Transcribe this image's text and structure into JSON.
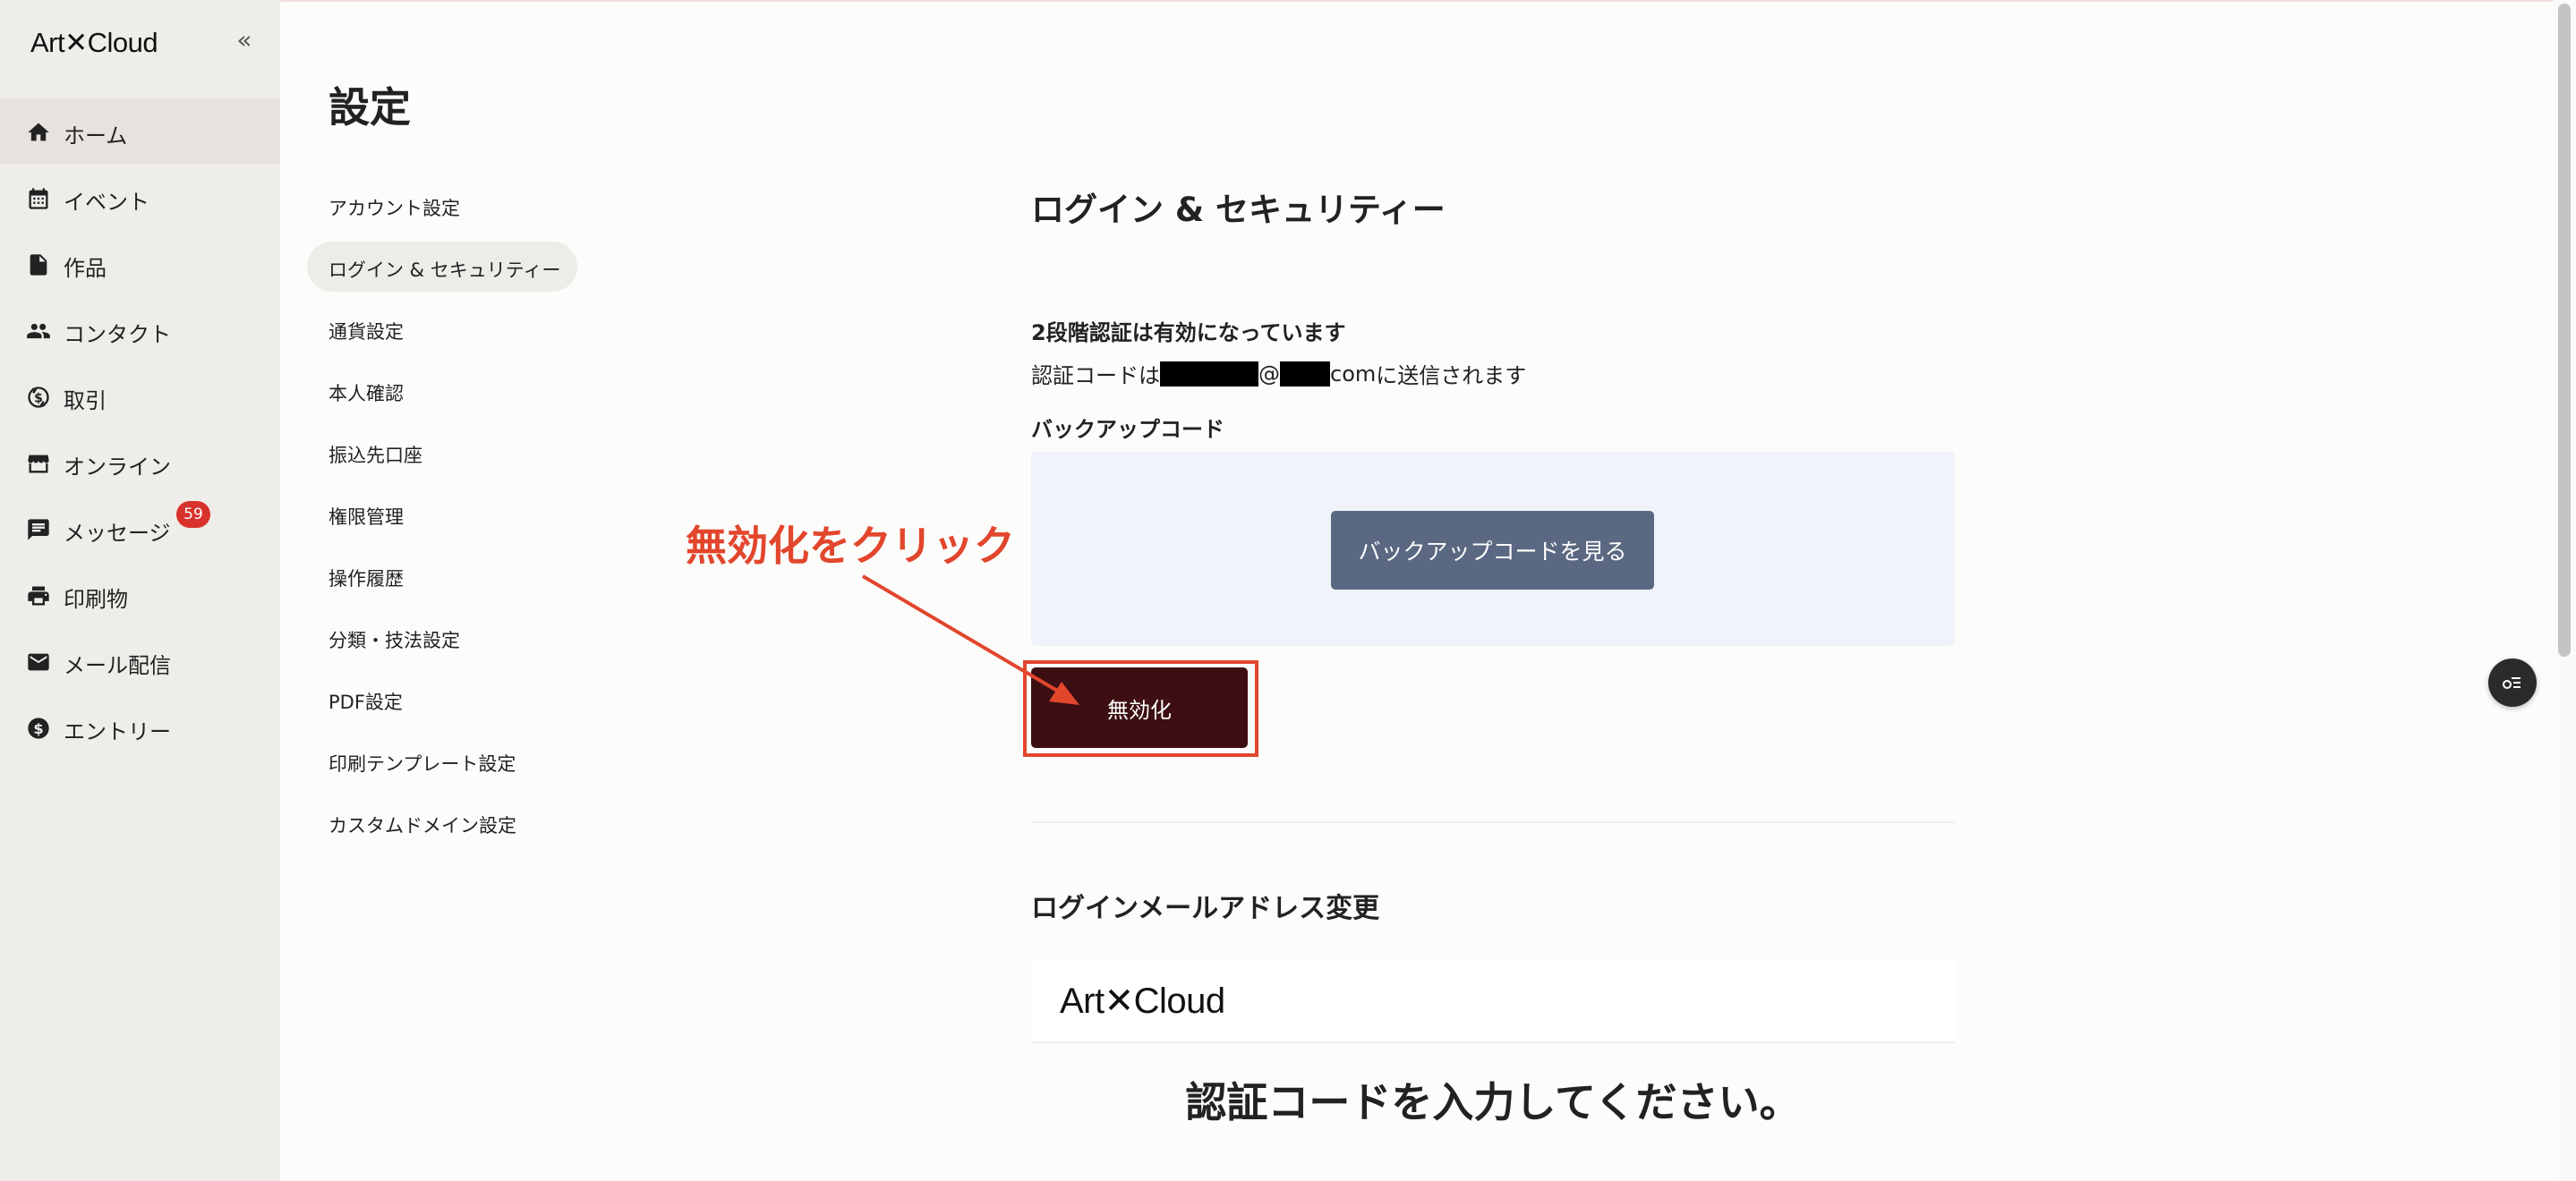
{
  "app": {
    "logo": "Art✕Cloud",
    "collapse_icon": "«"
  },
  "nav": {
    "items": [
      {
        "label": "ホーム",
        "icon": "home-icon"
      },
      {
        "label": "イベント",
        "icon": "calendar-icon"
      },
      {
        "label": "作品",
        "icon": "document-icon"
      },
      {
        "label": "コンタクト",
        "icon": "people-icon"
      },
      {
        "label": "取引",
        "icon": "exchange-icon"
      },
      {
        "label": "オンライン",
        "icon": "storefront-icon"
      },
      {
        "label": "メッセージ",
        "icon": "chat-icon"
      },
      {
        "label": "印刷物",
        "icon": "printer-icon"
      },
      {
        "label": "メール配信",
        "icon": "mail-icon"
      },
      {
        "label": "エントリー",
        "icon": "dollar-icon"
      }
    ],
    "message_badge": "59"
  },
  "settings": {
    "title": "設定",
    "menu": [
      "アカウント設定",
      "ログイン & セキュリティー",
      "通貨設定",
      "本人確認",
      "振込先口座",
      "権限管理",
      "操作履歴",
      "分類・技法設定",
      "PDF設定",
      "印刷テンプレート設定",
      "カスタムドメイン設定"
    ]
  },
  "security": {
    "title": "ログイン & セキュリティー",
    "twofa_status": "2段階認証は有効になっています",
    "code_prefix": "認証コードは",
    "code_at": "@",
    "code_domain_tail": "com",
    "code_suffix": "に送信されます",
    "backup_label": "バックアップコード",
    "backup_button": "バックアップコードを見る",
    "disable_button": "無効化",
    "annotation": "無効化をクリック"
  },
  "email_change": {
    "title": "ログインメールアドレス変更",
    "preview_logo": "Art✕Cloud",
    "preview_heading": "認証コードを入力してください。"
  },
  "colors": {
    "accent_red": "#e2462c",
    "disable_button_bg": "#3d0f12",
    "backup_button_bg": "#5b6882",
    "badge_red": "#d8322c"
  }
}
